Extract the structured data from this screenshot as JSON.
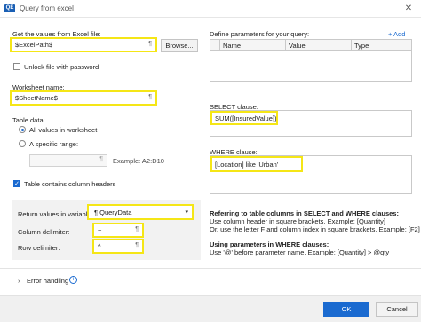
{
  "window": {
    "title": "Query from excel",
    "app_icon": "excel-query-icon"
  },
  "left": {
    "values_label": "Get the values from Excel file:",
    "file_value": "$ExcelPath$",
    "browse_label": "Browse...",
    "unlock_label": "Unlock file with password",
    "unlock_checked": false,
    "worksheet_label": "Worksheet name:",
    "worksheet_value": "$SheetName$",
    "table_data_label": "Table data:",
    "radio_all": "All values in worksheet",
    "radio_range": "A specific range:",
    "range_placeholder": "",
    "range_example": "Example: A2:D10",
    "headers_label": "Table contains column headers",
    "headers_checked": true,
    "return_label": "Return values in variable:",
    "return_value": "QueryData",
    "column_delim_label": "Column delimiter:",
    "column_delim_value": "~",
    "row_delim_label": "Row delimiter:",
    "row_delim_value": "^"
  },
  "right": {
    "params_label": "Define parameters for your query:",
    "add_label": "+ Add",
    "param_columns": [
      "Name",
      "Value",
      "Type"
    ],
    "select_label": "SELECT clause:",
    "select_value": "SUM([InsuredValue])",
    "where_label": "WHERE clause:",
    "where_value": "[Location] like 'Urban'",
    "help1_title": "Referring to table columns in SELECT and WHERE clauses:",
    "help1_line1": "Use column header in square brackets. Example: [Quantity]",
    "help1_line2": "Or, use the letter F and column index in square brackets. Example: [F2]",
    "help2_title": "Using parameters in WHERE clauses:",
    "help2_line1": "Use '@' before parameter name. Example: [Quantity] > @qty"
  },
  "error_handling": {
    "label": "Error handling"
  },
  "footer": {
    "ok_label": "OK",
    "cancel_label": "Cancel"
  },
  "colors": {
    "highlight": "#f5e616",
    "accent": "#1a6ad0"
  }
}
